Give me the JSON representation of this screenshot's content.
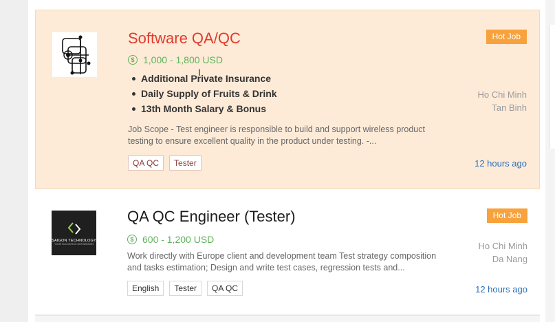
{
  "jobs": [
    {
      "title": "Software QA/QC",
      "salary": "1,000 - 1,800 USD",
      "currency_icon": "dollar-circle-icon",
      "benefits": [
        "Additional Private Insurance",
        "Daily Supply of Fruits & Drink",
        "13th Month Salary & Bonus"
      ],
      "description": "Job Scope - Test engineer is responsible to build and support wireless product testing to ensure excellent quality in the product under testing.   -...",
      "tags": [
        "QA QC",
        "Tester"
      ],
      "badge": "Hot Job",
      "location": [
        "Ho Chi Minh",
        "Tan Binh"
      ],
      "posted": "12 hours ago",
      "highlight_color": "#fdebd8"
    },
    {
      "title": "QA QC Engineer (Tester)",
      "salary": "600 - 1,200 USD",
      "currency_icon": "dollar-circle-icon",
      "company_logo_text": "SAIGON TECHNOLOGY",
      "company_logo_sub": "YOUR SUCCESS IS OUR MISSION",
      "description": "Work directly with Europe client and development team Test strategy composition and tasks estimation; Design and write test cases, regression tests and...",
      "tags": [
        "English",
        "Tester",
        "QA QC"
      ],
      "badge": "Hot Job",
      "location": [
        "Ho Chi Minh",
        "Da Nang"
      ],
      "posted": "12 hours ago"
    }
  ],
  "colors": {
    "title_highlight": "#e03b2c",
    "salary": "#5fb35a",
    "badge": "#f7a23c",
    "time": "#2a6fbf"
  }
}
